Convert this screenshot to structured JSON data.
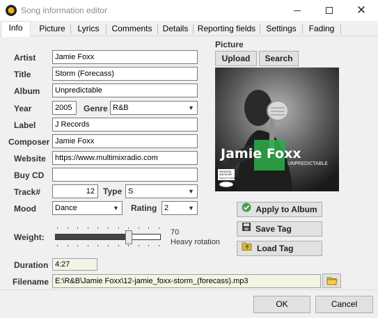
{
  "window": {
    "title": "Song information editor"
  },
  "tabs": [
    {
      "label": "Info"
    },
    {
      "label": "Picture"
    },
    {
      "label": "Lyrics"
    },
    {
      "label": "Comments"
    },
    {
      "label": "Details"
    },
    {
      "label": "Reporting fields"
    },
    {
      "label": "Settings"
    },
    {
      "label": "Fading"
    }
  ],
  "labels": {
    "artist": "Artist",
    "title": "Title",
    "album": "Album",
    "year": "Year",
    "genre": "Genre",
    "label": "Label",
    "composer": "Composer",
    "website": "Website",
    "buycd": "Buy CD",
    "track": "Track#",
    "type": "Type",
    "mood": "Mood",
    "rating": "Rating",
    "weight": "Weight:",
    "duration": "Duration",
    "filename": "Filename",
    "picture": "Picture"
  },
  "fields": {
    "artist": "Jamie Foxx",
    "title": "Storm (Forecass)",
    "album": "Unpredictable",
    "year": "2005",
    "genre": "R&B",
    "label": "J Records",
    "composer": "Jamie Foxx",
    "website": "https://www.multimixradio.com",
    "buycd": "",
    "track": "12",
    "type": "S",
    "mood": "Dance",
    "rating": "2",
    "duration": "4:27",
    "filename": "E:\\R&B\\Jamie Foxx\\12-jamie_foxx-storm_(forecass).mp3"
  },
  "weight": {
    "value": "70",
    "caption": "Heavy rotation",
    "fraction": 0.7
  },
  "cover": {
    "artist_text": "Jamie Foxx",
    "album_text": "UNPREDICTABLE",
    "advisory_line1": "PARENTAL",
    "advisory_line2": "ADVISORY",
    "advisory_line3": "EXPLICIT CONTENT"
  },
  "buttons": {
    "upload": "Upload",
    "search": "Search",
    "apply": "Apply to Album",
    "save": "Save Tag",
    "load": "Load Tag",
    "ok": "OK",
    "cancel": "Cancel"
  },
  "colors": {
    "apply_icon": "#3fa34d",
    "accent": "#0078d7"
  }
}
